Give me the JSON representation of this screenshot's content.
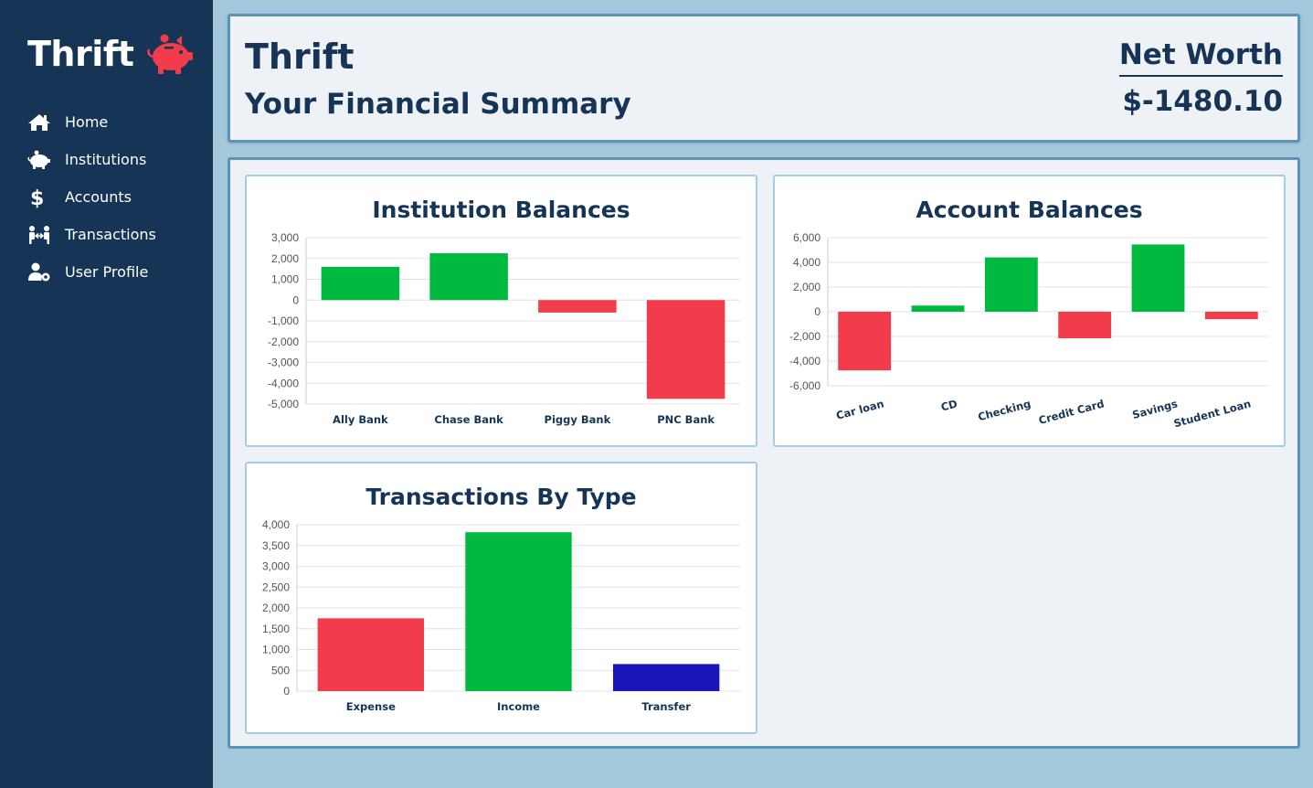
{
  "sidebar": {
    "brand": "Thrift",
    "logo_icon": "piggy-bank-icon",
    "items": [
      {
        "label": "Home",
        "icon": "home-icon"
      },
      {
        "label": "Institutions",
        "icon": "piggy-bank-icon"
      },
      {
        "label": "Accounts",
        "icon": "dollar-icon"
      },
      {
        "label": "Transactions",
        "icon": "people-exchange-icon"
      },
      {
        "label": "User Profile",
        "icon": "user-cog-icon"
      }
    ]
  },
  "header": {
    "title": "Thrift",
    "subtitle": "Your Financial Summary",
    "net_worth_label": "Net Worth",
    "net_worth_value": "$-1480.10"
  },
  "colors": {
    "positive": "#00b93f",
    "negative": "#f23c4b",
    "transfer": "#1816b8",
    "navy": "#163556"
  },
  "chart_data": [
    {
      "type": "bar",
      "title": "Institution Balances",
      "categories": [
        "Ally Bank",
        "Chase Bank",
        "Piggy Bank",
        "PNC Bank"
      ],
      "values": [
        1600,
        2250,
        -600,
        -4750
      ],
      "ylim": [
        -5000,
        3000
      ],
      "yticks": [
        3000,
        2000,
        1000,
        0,
        -1000,
        -2000,
        -3000,
        -4000,
        -5000
      ],
      "grid": true
    },
    {
      "type": "bar",
      "title": "Account Balances",
      "categories": [
        "Car loan",
        "CD",
        "Checking",
        "Credit Card",
        "Savings",
        "Student Loan"
      ],
      "values": [
        -4750,
        500,
        4400,
        -2150,
        5450,
        -600
      ],
      "ylim": [
        -6000,
        6000
      ],
      "yticks": [
        6000,
        4000,
        2000,
        0,
        -2000,
        -4000,
        -6000
      ],
      "grid": true
    },
    {
      "type": "bar",
      "title": "Transactions By Type",
      "categories": [
        "Expense",
        "Income",
        "Transfer"
      ],
      "values": [
        1750,
        3820,
        650
      ],
      "ylim": [
        0,
        4000
      ],
      "yticks": [
        4000,
        3500,
        3000,
        2500,
        2000,
        1500,
        1000,
        500,
        0
      ],
      "grid": true
    }
  ]
}
